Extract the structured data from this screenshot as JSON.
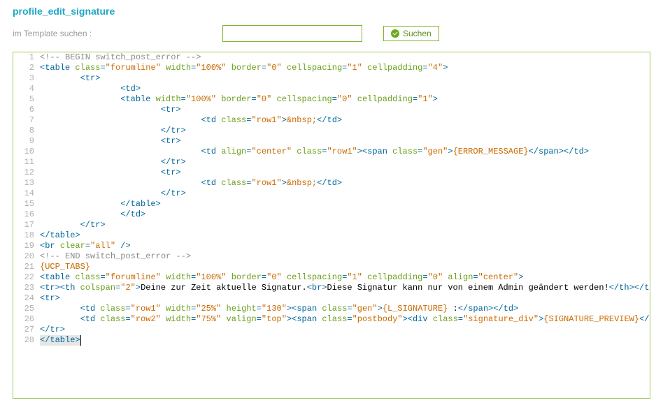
{
  "title": "profile_edit_signature",
  "search": {
    "label": "im Template suchen :",
    "placeholder": "",
    "value": "",
    "button_label": "Suchen"
  },
  "editor": {
    "cursor_line": 28,
    "lines": [
      {
        "num": 1,
        "indent": 0,
        "tokens": [
          [
            "comment",
            "<!-- BEGIN switch_post_error -->"
          ]
        ]
      },
      {
        "num": 2,
        "indent": 0,
        "tokens": [
          [
            "tag",
            "<table"
          ],
          [
            "text",
            " "
          ],
          [
            "attr",
            "class"
          ],
          [
            "tag",
            "="
          ],
          [
            "val",
            "\"forumline\""
          ],
          [
            "text",
            " "
          ],
          [
            "attr",
            "width"
          ],
          [
            "tag",
            "="
          ],
          [
            "val",
            "\"100%\""
          ],
          [
            "text",
            " "
          ],
          [
            "attr",
            "border"
          ],
          [
            "tag",
            "="
          ],
          [
            "val",
            "\"0\""
          ],
          [
            "text",
            " "
          ],
          [
            "attr",
            "cellspacing"
          ],
          [
            "tag",
            "="
          ],
          [
            "val",
            "\"1\""
          ],
          [
            "text",
            " "
          ],
          [
            "attr",
            "cellpadding"
          ],
          [
            "tag",
            "="
          ],
          [
            "val",
            "\"4\""
          ],
          [
            "tag",
            ">"
          ]
        ]
      },
      {
        "num": 3,
        "indent": 8,
        "tokens": [
          [
            "tag",
            "<tr>"
          ]
        ]
      },
      {
        "num": 4,
        "indent": 16,
        "tokens": [
          [
            "tag",
            "<td>"
          ]
        ]
      },
      {
        "num": 5,
        "indent": 16,
        "tokens": [
          [
            "tag",
            "<table"
          ],
          [
            "text",
            " "
          ],
          [
            "attr",
            "width"
          ],
          [
            "tag",
            "="
          ],
          [
            "val",
            "\"100%\""
          ],
          [
            "text",
            " "
          ],
          [
            "attr",
            "border"
          ],
          [
            "tag",
            "="
          ],
          [
            "val",
            "\"0\""
          ],
          [
            "text",
            " "
          ],
          [
            "attr",
            "cellspacing"
          ],
          [
            "tag",
            "="
          ],
          [
            "val",
            "\"0\""
          ],
          [
            "text",
            " "
          ],
          [
            "attr",
            "cellpadding"
          ],
          [
            "tag",
            "="
          ],
          [
            "val",
            "\"1\""
          ],
          [
            "tag",
            ">"
          ]
        ]
      },
      {
        "num": 6,
        "indent": 24,
        "tokens": [
          [
            "tag",
            "<tr>"
          ]
        ]
      },
      {
        "num": 7,
        "indent": 32,
        "tokens": [
          [
            "tag",
            "<td"
          ],
          [
            "text",
            " "
          ],
          [
            "attr",
            "class"
          ],
          [
            "tag",
            "="
          ],
          [
            "val",
            "\"row1\""
          ],
          [
            "tag",
            ">"
          ],
          [
            "entity",
            "&nbsp;"
          ],
          [
            "tag",
            "</td>"
          ]
        ]
      },
      {
        "num": 8,
        "indent": 24,
        "tokens": [
          [
            "tag",
            "</tr>"
          ]
        ]
      },
      {
        "num": 9,
        "indent": 24,
        "tokens": [
          [
            "tag",
            "<tr>"
          ]
        ]
      },
      {
        "num": 10,
        "indent": 32,
        "tokens": [
          [
            "tag",
            "<td"
          ],
          [
            "text",
            " "
          ],
          [
            "attr",
            "align"
          ],
          [
            "tag",
            "="
          ],
          [
            "val",
            "\"center\""
          ],
          [
            "text",
            " "
          ],
          [
            "attr",
            "class"
          ],
          [
            "tag",
            "="
          ],
          [
            "val",
            "\"row1\""
          ],
          [
            "tag",
            "><span"
          ],
          [
            "text",
            " "
          ],
          [
            "attr",
            "class"
          ],
          [
            "tag",
            "="
          ],
          [
            "val",
            "\"gen\""
          ],
          [
            "tag",
            ">"
          ],
          [
            "brace",
            "{ERROR_MESSAGE}"
          ],
          [
            "tag",
            "</span></td>"
          ]
        ]
      },
      {
        "num": 11,
        "indent": 24,
        "tokens": [
          [
            "tag",
            "</tr>"
          ]
        ]
      },
      {
        "num": 12,
        "indent": 24,
        "tokens": [
          [
            "tag",
            "<tr>"
          ]
        ]
      },
      {
        "num": 13,
        "indent": 32,
        "tokens": [
          [
            "tag",
            "<td"
          ],
          [
            "text",
            " "
          ],
          [
            "attr",
            "class"
          ],
          [
            "tag",
            "="
          ],
          [
            "val",
            "\"row1\""
          ],
          [
            "tag",
            ">"
          ],
          [
            "entity",
            "&nbsp;"
          ],
          [
            "tag",
            "</td>"
          ]
        ]
      },
      {
        "num": 14,
        "indent": 24,
        "tokens": [
          [
            "tag",
            "</tr>"
          ]
        ]
      },
      {
        "num": 15,
        "indent": 16,
        "tokens": [
          [
            "tag",
            "</table>"
          ]
        ]
      },
      {
        "num": 16,
        "indent": 16,
        "tokens": [
          [
            "tag",
            "</td>"
          ]
        ]
      },
      {
        "num": 17,
        "indent": 8,
        "tokens": [
          [
            "tag",
            "</tr>"
          ]
        ]
      },
      {
        "num": 18,
        "indent": 0,
        "tokens": [
          [
            "tag",
            "</table>"
          ]
        ]
      },
      {
        "num": 19,
        "indent": 0,
        "tokens": [
          [
            "tag",
            "<br"
          ],
          [
            "text",
            " "
          ],
          [
            "attr",
            "clear"
          ],
          [
            "tag",
            "="
          ],
          [
            "val",
            "\"all\""
          ],
          [
            "text",
            " "
          ],
          [
            "tag",
            "/>"
          ]
        ]
      },
      {
        "num": 20,
        "indent": 0,
        "tokens": [
          [
            "comment",
            "<!-- END switch_post_error -->"
          ]
        ]
      },
      {
        "num": 21,
        "indent": 0,
        "tokens": [
          [
            "brace",
            "{UCP_TABS}"
          ]
        ]
      },
      {
        "num": 22,
        "indent": 0,
        "tokens": [
          [
            "tag",
            "<table"
          ],
          [
            "text",
            " "
          ],
          [
            "attr",
            "class"
          ],
          [
            "tag",
            "="
          ],
          [
            "val",
            "\"forumline\""
          ],
          [
            "text",
            " "
          ],
          [
            "attr",
            "width"
          ],
          [
            "tag",
            "="
          ],
          [
            "val",
            "\"100%\""
          ],
          [
            "text",
            " "
          ],
          [
            "attr",
            "border"
          ],
          [
            "tag",
            "="
          ],
          [
            "val",
            "\"0\""
          ],
          [
            "text",
            " "
          ],
          [
            "attr",
            "cellspacing"
          ],
          [
            "tag",
            "="
          ],
          [
            "val",
            "\"1\""
          ],
          [
            "text",
            " "
          ],
          [
            "attr",
            "cellpadding"
          ],
          [
            "tag",
            "="
          ],
          [
            "val",
            "\"0\""
          ],
          [
            "text",
            " "
          ],
          [
            "attr",
            "align"
          ],
          [
            "tag",
            "="
          ],
          [
            "val",
            "\"center\""
          ],
          [
            "tag",
            ">"
          ]
        ]
      },
      {
        "num": 23,
        "indent": 0,
        "tokens": [
          [
            "tag",
            "<tr><th"
          ],
          [
            "text",
            " "
          ],
          [
            "attr",
            "colspan"
          ],
          [
            "tag",
            "="
          ],
          [
            "val",
            "\"2\""
          ],
          [
            "tag",
            ">"
          ],
          [
            "text",
            "Deine zur Zeit aktuelle Signatur."
          ],
          [
            "tag",
            "<br>"
          ],
          [
            "text",
            "Diese Signatur kann nur von einem Admin geändert werden!"
          ],
          [
            "tag",
            "</th></tr>"
          ]
        ]
      },
      {
        "num": 24,
        "indent": 0,
        "tokens": [
          [
            "tag",
            "<tr>"
          ]
        ]
      },
      {
        "num": 25,
        "indent": 8,
        "tokens": [
          [
            "tag",
            "<td"
          ],
          [
            "text",
            " "
          ],
          [
            "attr",
            "class"
          ],
          [
            "tag",
            "="
          ],
          [
            "val",
            "\"row1\""
          ],
          [
            "text",
            " "
          ],
          [
            "attr",
            "width"
          ],
          [
            "tag",
            "="
          ],
          [
            "val",
            "\"25%\""
          ],
          [
            "text",
            " "
          ],
          [
            "attr",
            "height"
          ],
          [
            "tag",
            "="
          ],
          [
            "val",
            "\"130\""
          ],
          [
            "tag",
            "><span"
          ],
          [
            "text",
            " "
          ],
          [
            "attr",
            "class"
          ],
          [
            "tag",
            "="
          ],
          [
            "val",
            "\"gen\""
          ],
          [
            "tag",
            ">"
          ],
          [
            "brace",
            "{L_SIGNATURE}"
          ],
          [
            "text",
            " :"
          ],
          [
            "tag",
            "</span></td>"
          ]
        ]
      },
      {
        "num": 26,
        "indent": 8,
        "tokens": [
          [
            "tag",
            "<td"
          ],
          [
            "text",
            " "
          ],
          [
            "attr",
            "class"
          ],
          [
            "tag",
            "="
          ],
          [
            "val",
            "\"row2\""
          ],
          [
            "text",
            " "
          ],
          [
            "attr",
            "width"
          ],
          [
            "tag",
            "="
          ],
          [
            "val",
            "\"75%\""
          ],
          [
            "text",
            " "
          ],
          [
            "attr",
            "valign"
          ],
          [
            "tag",
            "="
          ],
          [
            "val",
            "\"top\""
          ],
          [
            "tag",
            "><span"
          ],
          [
            "text",
            " "
          ],
          [
            "attr",
            "class"
          ],
          [
            "tag",
            "="
          ],
          [
            "val",
            "\"postbody\""
          ],
          [
            "tag",
            "><div"
          ],
          [
            "text",
            " "
          ],
          [
            "attr",
            "class"
          ],
          [
            "tag",
            "="
          ],
          [
            "val",
            "\"signature_div\""
          ],
          [
            "tag",
            ">"
          ],
          [
            "brace",
            "{SIGNATURE_PREVIEW}"
          ],
          [
            "tag",
            "</div></"
          ]
        ]
      },
      {
        "num": 27,
        "indent": 0,
        "tokens": [
          [
            "tag",
            "</tr>"
          ]
        ]
      },
      {
        "num": 28,
        "indent": 0,
        "tokens": [
          [
            "tag",
            "</table>"
          ]
        ]
      }
    ]
  }
}
